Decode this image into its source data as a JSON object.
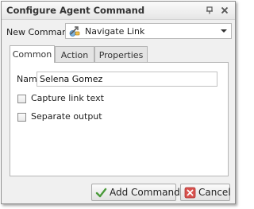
{
  "window": {
    "title": "Configure Agent Command",
    "titlebar_buttons": [
      "pin-icon",
      "maximize-icon",
      "close-icon"
    ]
  },
  "command": {
    "label": "New Command",
    "selected": "Navigate Link",
    "selected_icon": "navigate-link-icon"
  },
  "tabs": [
    {
      "label": "Common",
      "active": true
    },
    {
      "label": "Action",
      "active": false
    },
    {
      "label": "Properties",
      "active": false
    }
  ],
  "common": {
    "name_label": "Name",
    "name_value": "Selena Gomez",
    "capture_link_text": {
      "label": "Capture link text",
      "checked": false
    },
    "separate_output": {
      "label": "Separate output",
      "checked": false
    }
  },
  "buttons": {
    "add": "Add Command",
    "cancel": "Cancel"
  },
  "colors": {
    "check_green": "#4a9a3a",
    "cancel_red": "#c0392b"
  }
}
